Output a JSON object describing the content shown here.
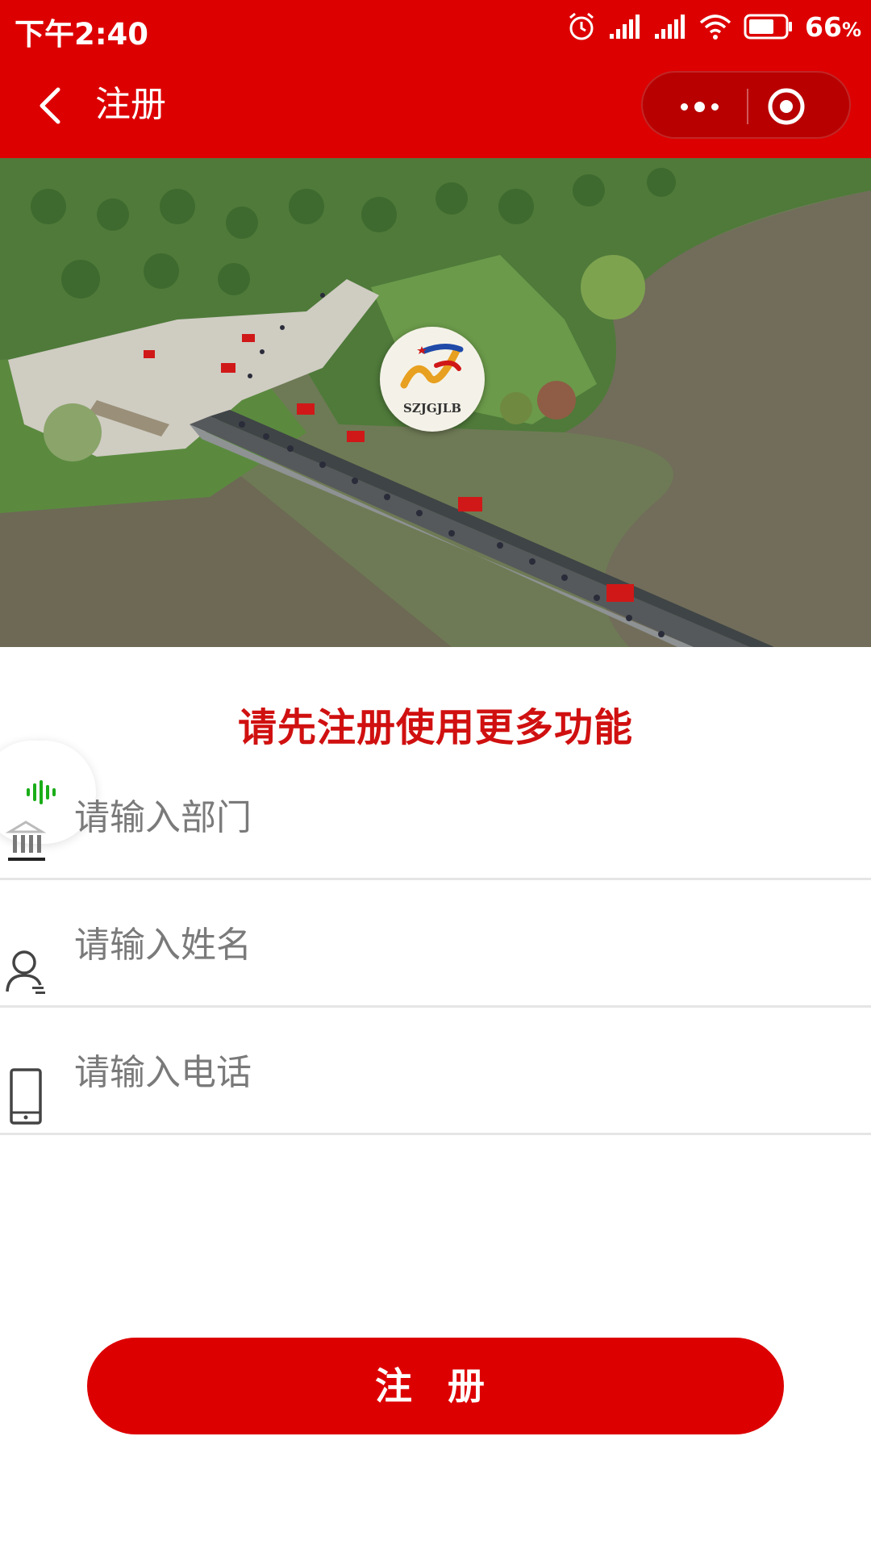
{
  "status_bar": {
    "time": "下午2:40",
    "battery": "66",
    "battery_unit": "%"
  },
  "nav": {
    "title": "注册",
    "back_icon": "chevron-left-icon",
    "more_icon": "more-dots-icon",
    "close_icon": "mini-program-close-icon"
  },
  "banner": {
    "logo_text": "SZJGJLB"
  },
  "headline": "请先注册使用更多功能",
  "form": {
    "department": {
      "placeholder": "请输入部门",
      "icon": "building-icon"
    },
    "name": {
      "placeholder": "请输入姓名",
      "icon": "user-icon"
    },
    "phone": {
      "placeholder": "请输入电话",
      "icon": "phone-icon"
    }
  },
  "register_button": "注 册",
  "colors": {
    "primary": "#dd0000",
    "headline": "#d01010",
    "voice_accent": "#1aad19"
  }
}
